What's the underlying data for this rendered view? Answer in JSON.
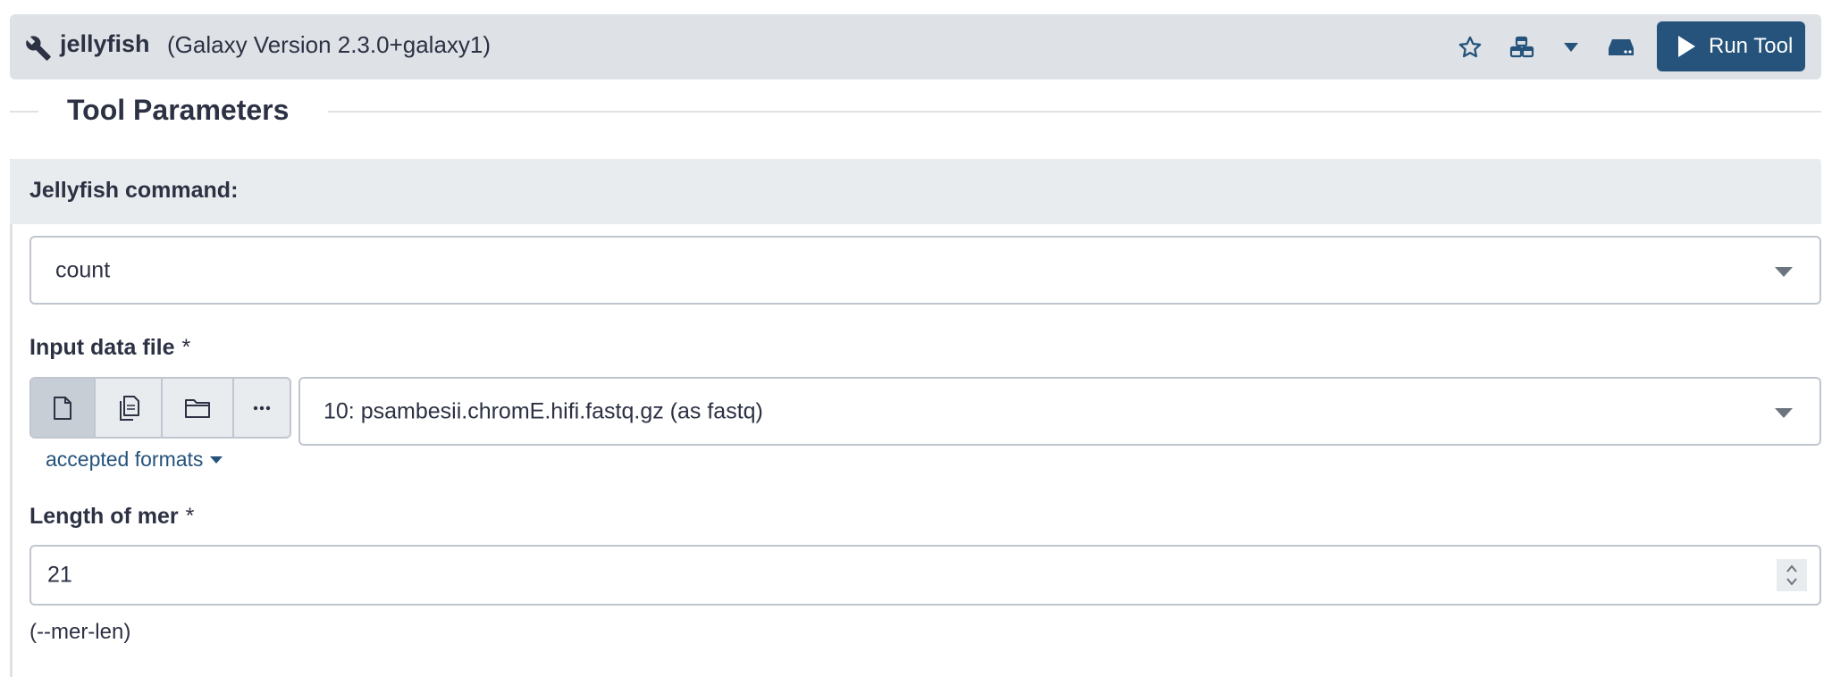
{
  "header": {
    "tool_name": "jellyfish",
    "tool_version": "(Galaxy Version 2.3.0+galaxy1)",
    "run_label": "Run Tool",
    "icons": [
      "wrench-icon",
      "star-icon",
      "cubes-icon",
      "caret-down-icon",
      "hdd-icon",
      "play-icon"
    ]
  },
  "section": {
    "title": "Tool Parameters"
  },
  "command": {
    "label": "Jellyfish command:",
    "selected": "count"
  },
  "input_file": {
    "label": "Input data file",
    "required_mark": "*",
    "selected": "10: psambesii.chromE.hifi.fastq.gz (as fastq)",
    "source_buttons": [
      "file-icon",
      "files-icon",
      "folder-icon",
      "ellipsis-icon"
    ],
    "accepted_formats_label": "accepted formats"
  },
  "mer_length": {
    "label": "Length of mer",
    "required_mark": "*",
    "value": "21",
    "help": "(--mer-len)"
  },
  "colors": {
    "primary": "#25537b",
    "header_bg": "#dee2e6",
    "panel_head_bg": "#e9ecef"
  }
}
